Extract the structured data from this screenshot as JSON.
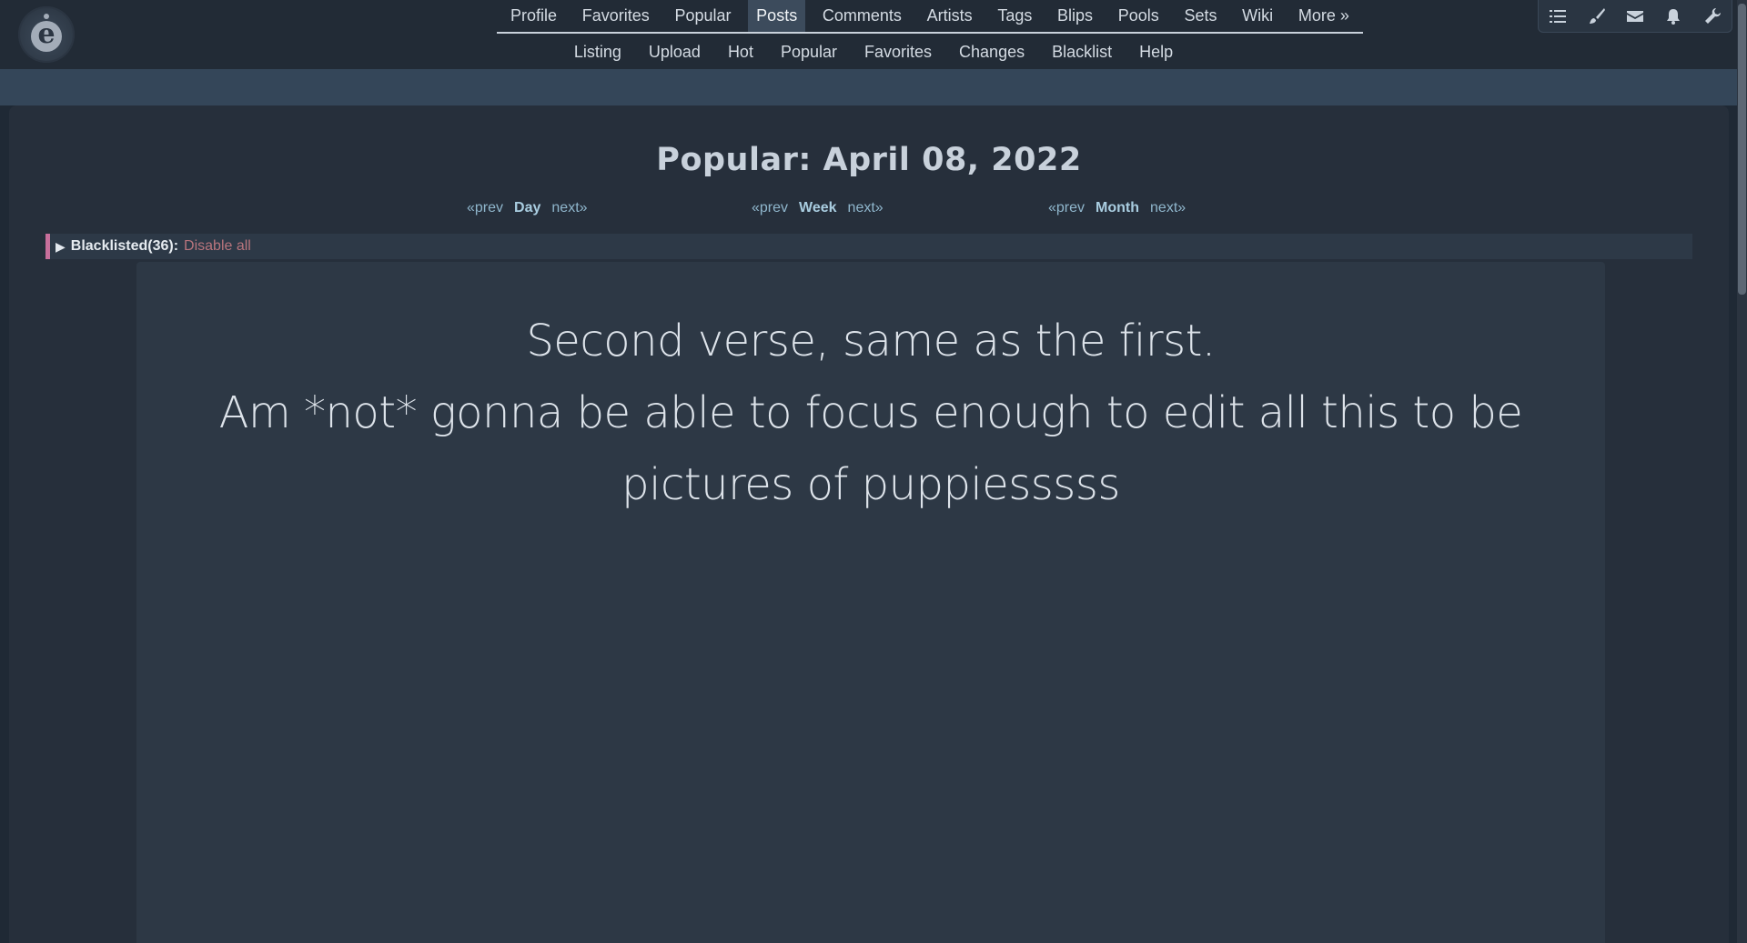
{
  "main_nav": [
    {
      "label": "Profile",
      "active": false
    },
    {
      "label": "Favorites",
      "active": false
    },
    {
      "label": "Popular",
      "active": false
    },
    {
      "label": "Posts",
      "active": true
    },
    {
      "label": "Comments",
      "active": false
    },
    {
      "label": "Artists",
      "active": false
    },
    {
      "label": "Tags",
      "active": false
    },
    {
      "label": "Blips",
      "active": false
    },
    {
      "label": "Pools",
      "active": false
    },
    {
      "label": "Sets",
      "active": false
    },
    {
      "label": "Wiki",
      "active": false
    },
    {
      "label": "More »",
      "active": false
    }
  ],
  "sub_nav": [
    "Listing",
    "Upload",
    "Hot",
    "Popular",
    "Favorites",
    "Changes",
    "Blacklist",
    "Help"
  ],
  "toolbar_icons": [
    "list-checks-icon",
    "brush-icon",
    "envelope-icon",
    "bell-icon",
    "wrench-icon"
  ],
  "page_title": "Popular: April 08, 2022",
  "ranges": {
    "day": {
      "prev": "«prev",
      "label": "Day",
      "next": "next»"
    },
    "week": {
      "prev": "«prev",
      "label": "Week",
      "next": "next»"
    },
    "month": {
      "prev": "«prev",
      "label": "Month",
      "next": "next»"
    }
  },
  "blacklist": {
    "toggle": "▶",
    "label": "Blacklisted(36):",
    "disable": "Disable all"
  },
  "post_text": {
    "line1": "Second verse, same as the first.",
    "line2": "Am *not* gonna be able to focus enough to edit all this to be",
    "line3": "pictures of puppiesssss"
  },
  "colors": {
    "accent_blacklist": "#c76f9b",
    "link": "#8fb6cc",
    "active_tab_bg": "#3c4b5c"
  }
}
